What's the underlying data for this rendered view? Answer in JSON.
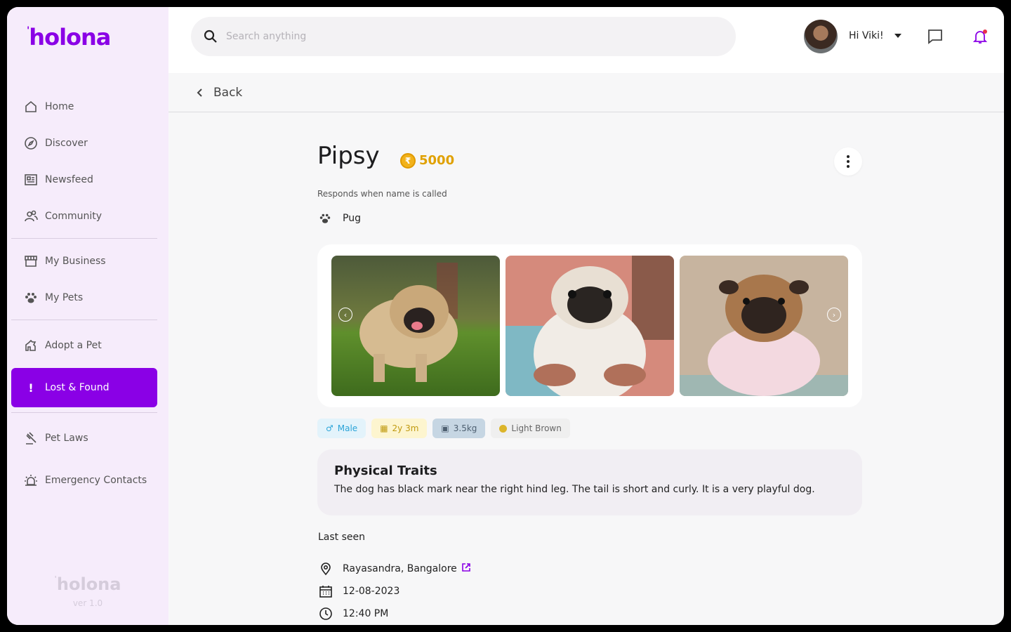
{
  "brand": {
    "name": "holona",
    "version": "ver 1.0",
    "accent": "#8a00e6"
  },
  "sidebar": {
    "items": [
      {
        "label": "Home",
        "icon": "home-icon"
      },
      {
        "label": "Discover",
        "icon": "compass-icon"
      },
      {
        "label": "Newsfeed",
        "icon": "newspaper-icon"
      },
      {
        "label": "Community",
        "icon": "people-icon"
      },
      {
        "label": "My Business",
        "icon": "store-icon"
      },
      {
        "label": "My Pets",
        "icon": "paw-icon"
      },
      {
        "label": "Adopt a Pet",
        "icon": "adopt-icon"
      },
      {
        "label": "Lost & Found",
        "icon": "exclamation-icon",
        "active": true
      },
      {
        "label": "Pet Laws",
        "icon": "gavel-icon"
      },
      {
        "label": "Emergency Contacts",
        "icon": "siren-icon"
      }
    ]
  },
  "header": {
    "search_placeholder": "Search anything",
    "greeting": "Hi Viki!"
  },
  "backbar": {
    "label": "Back"
  },
  "pet": {
    "name": "Pipsy",
    "reward": "5000",
    "note": "Responds when name is called",
    "breed": "Pug",
    "chips": {
      "gender": "Male",
      "age": "2y 3m",
      "weight": "3.5kg",
      "color": "Light Brown"
    },
    "traits_title": "Physical Traits",
    "traits_text": "The dog has black mark near the right hind leg. The tail is short and curly. It is a very playful dog."
  },
  "last_seen": {
    "title": "Last seen",
    "location": "Rayasandra, Bangalore",
    "date": "12-08-2023",
    "time": "12:40 PM"
  }
}
